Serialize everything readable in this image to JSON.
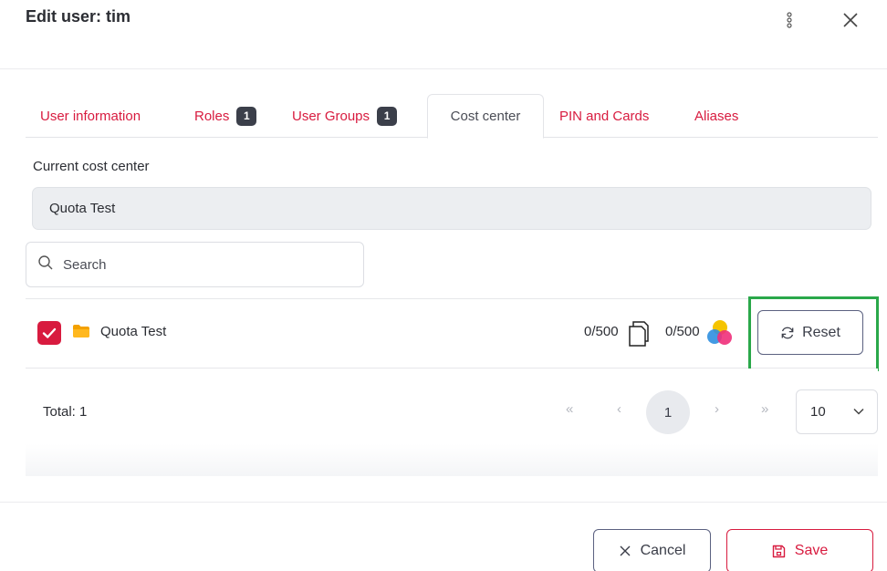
{
  "dialog": {
    "title": "Edit user: tim",
    "more_icon": "kebab-vertical-icon",
    "close_icon": "close-x-icon"
  },
  "tabs": [
    {
      "label": "User information",
      "badge": null,
      "active": false
    },
    {
      "label": "Roles",
      "badge": "1",
      "active": false
    },
    {
      "label": "User Groups",
      "badge": "1",
      "active": false
    },
    {
      "label": "Cost center",
      "badge": null,
      "active": true
    },
    {
      "label": "PIN and Cards",
      "badge": null,
      "active": false
    },
    {
      "label": "Aliases",
      "badge": null,
      "active": false
    }
  ],
  "current_cost_center": {
    "label": "Current cost center",
    "value": "Quota Test"
  },
  "search": {
    "placeholder": "Search",
    "value": ""
  },
  "rows": [
    {
      "checked": true,
      "icon": "folder-icon",
      "name": "Quota Test",
      "bw_quota": "0/500",
      "bw_icon": "pages-icon",
      "color_quota": "0/500",
      "color_icon": "color-cmy-icon",
      "action_label": "Reset"
    }
  ],
  "pagination": {
    "total_label": "Total: 1",
    "first": "«",
    "prev": "‹",
    "current_page": "1",
    "next": "›",
    "last": "»",
    "per_page": "10"
  },
  "footer": {
    "cancel_label": "Cancel",
    "save_label": "Save"
  },
  "colors": {
    "accent": "#d81b3f",
    "highlight": "#2aa84a",
    "badge_bg": "#3b3f4a"
  }
}
